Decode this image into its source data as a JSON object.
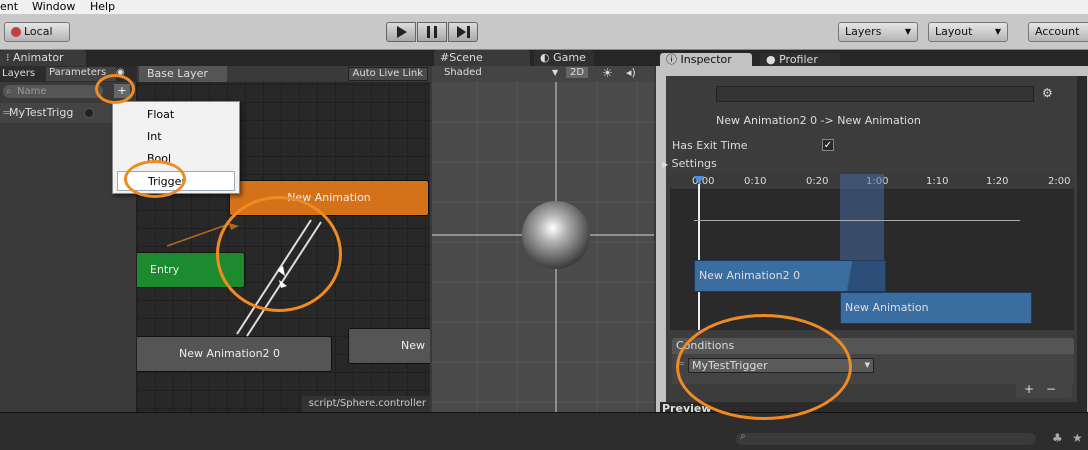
{
  "menubar": {
    "items": [
      "ent",
      "Window",
      "Help"
    ]
  },
  "toolbar": {
    "local_label": "Local",
    "layers_label": "Layers",
    "layout_label": "Layout",
    "account_label": "Account"
  },
  "tabs": {
    "animator": "Animator",
    "scene": "Scene",
    "game": "Game",
    "inspector": "Inspector",
    "profiler": "Profiler"
  },
  "animator": {
    "layers_tab": "Layers",
    "parameters_tab": "Parameters",
    "search_placeholder": "Name",
    "base_layer": "Base Layer",
    "auto_live_link": "Auto Live Link",
    "parameter_name": "MyTestTrigg",
    "footer_path": "script/Sphere.controller",
    "states": {
      "new_animation": "New Animation",
      "entry": "Entry",
      "new_animation2": "New Animation2 0",
      "partial": "New"
    }
  },
  "dropdown": {
    "items": [
      "Float",
      "Int",
      "Bool",
      "Trigger"
    ]
  },
  "scene": {
    "shading": "Shaded",
    "mode_2d": "2D"
  },
  "inspector": {
    "transition_title": "New Animation2 0 -> New Animation",
    "has_exit_time_label": "Has Exit Time",
    "has_exit_time": true,
    "settings_label": "Settings",
    "timeline_ticks": [
      "0:00",
      "0:10",
      "0:20",
      "1:00",
      "1:10",
      "1:20",
      "2:00"
    ],
    "clip_a": "New Animation2 0",
    "clip_b": "New Animation",
    "conditions_label": "Conditions",
    "condition_param": "MyTestTrigger",
    "add_label": "+",
    "remove_label": "−",
    "preview_label": "Preview"
  },
  "colors": {
    "accent": "#f08a24",
    "state_orange": "#d4721a",
    "state_green": "#1c8a2e",
    "clip_blue": "#3c6da0"
  }
}
